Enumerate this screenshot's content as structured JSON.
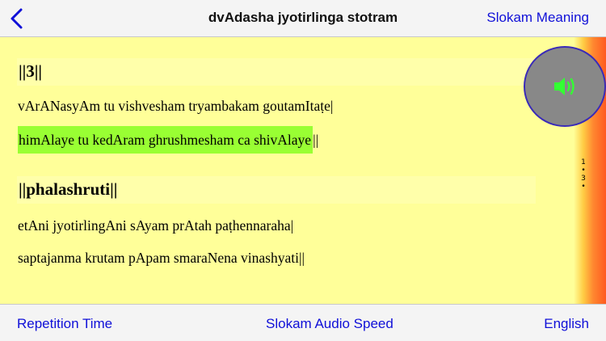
{
  "nav": {
    "title": "dvAdasha jyotirlinga stotram",
    "right_button": "Slokam Meaning",
    "back_icon": "chevron-left-icon"
  },
  "verses": [
    {
      "header": "||3||",
      "lines": [
        "vArANasyAm tu vishvesham tryambakam goutamItaṭe|",
        "himAlaye tu kedAram ghrushmesham ca shivAlaye",
        "||"
      ]
    },
    {
      "header": "||phalashruti||",
      "lines": [
        "etAni jyotirlingAni sAyam prAtah paṭhennaraha|",
        "saptajanma krutam pApam smaraNena vinashyati||"
      ]
    }
  ],
  "index": [
    "1",
    "•",
    "3",
    "•"
  ],
  "audio": {
    "icon": "speaker-icon"
  },
  "toolbar": {
    "left": "Repetition Time",
    "center": "Slokam Audio Speed",
    "right": "English"
  },
  "colors": {
    "accent": "#1010d8",
    "highlight": "#99ff33",
    "background": "#ffff99",
    "header_band": "#ffffaa",
    "audio_icon": "#33ff33"
  }
}
